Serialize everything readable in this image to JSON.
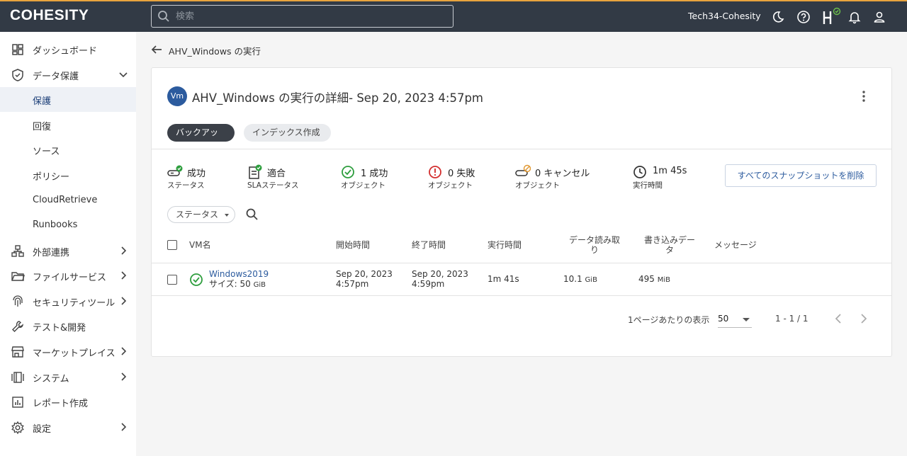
{
  "header": {
    "logo": "COHESITY",
    "search_placeholder": "検索",
    "username": "Tech34-Cohesity",
    "icons": [
      "moon-icon",
      "help-icon",
      "helios-icon",
      "bell-icon",
      "user-icon"
    ]
  },
  "sidebar": {
    "items": [
      {
        "label": "ダッシュボード",
        "icon": "dashboard-icon"
      },
      {
        "label": "データ保護",
        "icon": "shield-icon",
        "expanded": true
      },
      {
        "label": "保護",
        "active": true
      },
      {
        "label": "回復"
      },
      {
        "label": "ソース"
      },
      {
        "label": "ポリシー"
      },
      {
        "label": "CloudRetrieve"
      },
      {
        "label": "Runbooks"
      },
      {
        "label": "外部連携",
        "icon": "integration-icon"
      },
      {
        "label": "ファイルサービス",
        "icon": "folder-icon"
      },
      {
        "label": "セキュリティツール",
        "icon": "fingerprint-icon"
      },
      {
        "label": "テスト&開発",
        "icon": "wrench-icon"
      },
      {
        "label": "マーケットプレイス",
        "icon": "store-icon"
      },
      {
        "label": "システム",
        "icon": "system-icon"
      },
      {
        "label": "レポート作成",
        "icon": "report-icon"
      },
      {
        "label": "設定",
        "icon": "gear-icon"
      }
    ]
  },
  "breadcrumb": "AHV_Windows の実行",
  "card": {
    "badge": "Vm",
    "title": "AHV_Windows の実行の詳細- Sep 20, 2023 4:57pm",
    "tabs": [
      "バックアップ",
      "インデックス作成"
    ],
    "stats": [
      {
        "value": "成功",
        "label": "ステータス",
        "icon": "status-success-icon"
      },
      {
        "value": "適合",
        "label": "SLAステータス",
        "icon": "sla-icon"
      },
      {
        "value": "1 成功",
        "label": "オブジェクト",
        "icon": "check-circle-icon"
      },
      {
        "value": "0 失敗",
        "label": "オブジェクト",
        "icon": "error-icon"
      },
      {
        "value": "0 キャンセル",
        "label": "オブジェクト",
        "icon": "cancel-icon"
      },
      {
        "value": "1m 45s",
        "label": "実行時間",
        "icon": "clock-icon"
      }
    ],
    "delete_button": "すべてのスナップショットを削除",
    "filter_label": "ステータス",
    "columns": {
      "vm_name": "VM名",
      "start": "開始時間",
      "end": "終了時間",
      "duration": "実行時間",
      "data_read_1": "データ読み取",
      "data_read_2": "り",
      "data_written_1": "書き込みデー",
      "data_written_2": "タ",
      "message": "メッセージ"
    },
    "rows": [
      {
        "name": "Windows2019",
        "size_label": "サイズ: 50",
        "size_unit": "GiB",
        "start_date": "Sep 20, 2023",
        "start_time": "4:57pm",
        "end_date": "Sep 20, 2023",
        "end_time": "4:59pm",
        "duration": "1m 41s",
        "data_read": "10.1",
        "data_read_unit": "GiB",
        "data_written": "495",
        "data_written_unit": "MiB",
        "message": ""
      }
    ],
    "pagination": {
      "per_page_label": "1ページあたりの表示",
      "per_page": "50",
      "range": "1 - 1 / 1"
    }
  }
}
